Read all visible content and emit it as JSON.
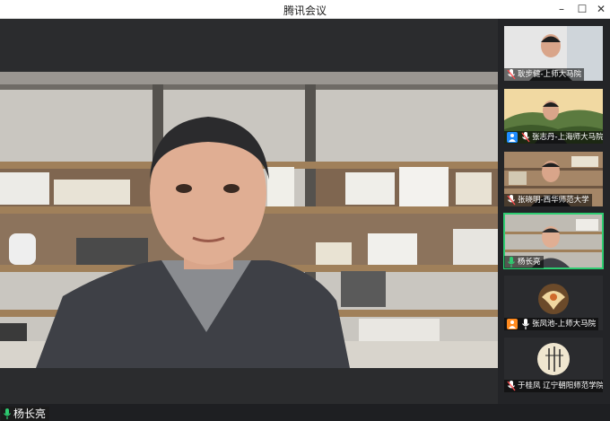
{
  "window": {
    "title": "腾讯会议",
    "controls": {
      "minimize": "–",
      "maximize": "☐",
      "close": "✕"
    }
  },
  "main": {
    "speaker": "杨长亮"
  },
  "participants": [
    {
      "name": "耿步健-上师大马院",
      "mic": "muted",
      "badge": false
    },
    {
      "name": "张志丹-上海师大马院",
      "mic": "muted",
      "badge": true
    },
    {
      "name": "张晓明-西华师范大学",
      "mic": "muted",
      "badge": false
    },
    {
      "name": "杨长亮",
      "mic": "active",
      "badge": false,
      "active": true
    },
    {
      "name": "张凤池-上师大马院",
      "mic": "active",
      "badge": true
    },
    {
      "name": "于桂凤 辽宁朝阳师范学院",
      "mic": "muted",
      "badge": false
    }
  ],
  "colors": {
    "active_border": "#2ecc71",
    "mic_active": "#2ecc71",
    "mic_muted": "#ff4d4f",
    "badge": "#1e8cff"
  }
}
